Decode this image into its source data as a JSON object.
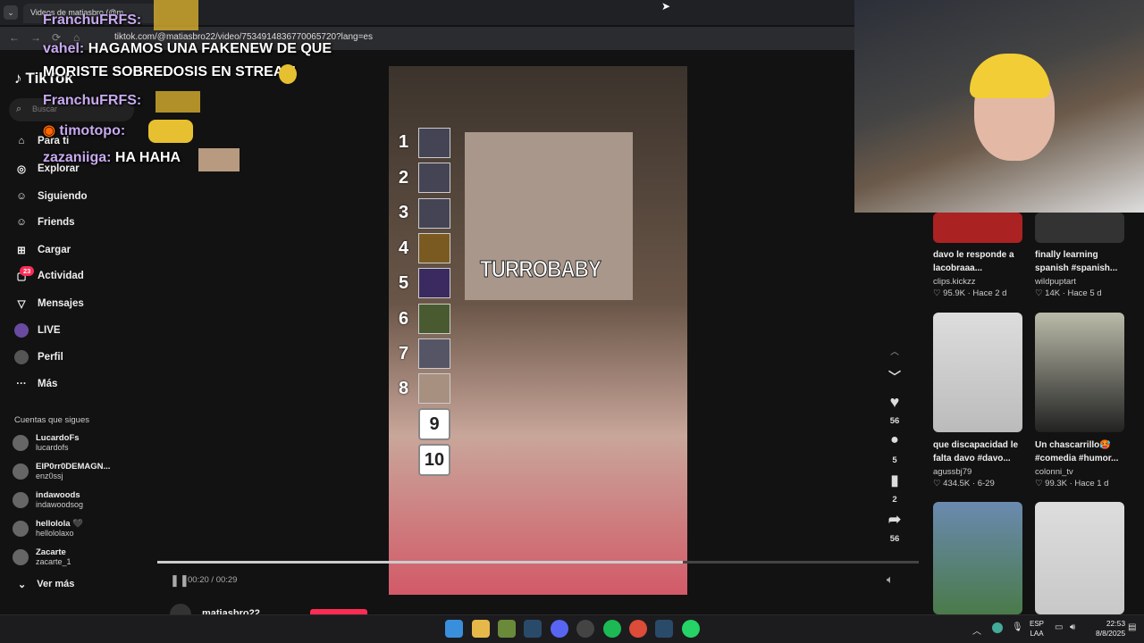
{
  "browser": {
    "tab_title": "Videos de matiasbro (@m",
    "url": "tiktok.com/@matiasbro22/video/7534914836770065720?lang=es"
  },
  "tiktok": {
    "logo": "TikTok",
    "search_placeholder": "Buscar",
    "nav": [
      {
        "label": "Para ti",
        "icon": "home-icon"
      },
      {
        "label": "Explorar",
        "icon": "compass-icon"
      },
      {
        "label": "Siguiendo",
        "icon": "following-icon"
      },
      {
        "label": "Friends",
        "icon": "friends-icon"
      },
      {
        "label": "Cargar",
        "icon": "upload-icon"
      },
      {
        "label": "Actividad",
        "icon": "inbox-icon",
        "badge": "23"
      },
      {
        "label": "Mensajes",
        "icon": "messages-icon"
      },
      {
        "label": "LIVE",
        "icon": "live-icon"
      },
      {
        "label": "Perfil",
        "icon": "avatar-icon"
      },
      {
        "label": "Más",
        "icon": "more-icon"
      }
    ],
    "following_heading": "Cuentas que sigues",
    "following": [
      {
        "name": "LucardoFs",
        "handle": "lucardofs"
      },
      {
        "name": "ElP0rr0DEMAGN...",
        "handle": "enz0ssj"
      },
      {
        "name": "indawoods",
        "handle": "indawoodsog"
      },
      {
        "name": "hellolola 🖤",
        "handle": "hellololaxo"
      },
      {
        "name": "Zacarte",
        "handle": "zacarte_1"
      }
    ],
    "see_more": "Ver más",
    "author_partial": "matiasbro22"
  },
  "video": {
    "overlay_text": "TURROBABY",
    "ranks": [
      "1",
      "2",
      "3",
      "4",
      "5",
      "6",
      "7",
      "8"
    ],
    "rank_boxes": [
      "9",
      "10"
    ],
    "time": "00:20 / 00:29",
    "progress_fraction": 0.69,
    "likes": "56",
    "comments": "5",
    "saves": "2",
    "shares": "56"
  },
  "chat": [
    {
      "user": "FranchuFRFS:",
      "msg": ""
    },
    {
      "user": "vahel:",
      "msg": "HAGAMOS UNA FAKENEW DE QUE"
    },
    {
      "user": "",
      "msg": "MORISTE SOBREDOSIS EN STREAM"
    },
    {
      "user": "FranchuFRFS:",
      "msg": ""
    },
    {
      "user": "timotopo:",
      "msg": ""
    },
    {
      "user": "zazaniiga:",
      "msg": "HA HAHA"
    }
  ],
  "recommendations": [
    {
      "title": "davo le responde a lacobraaa...",
      "author": "clips.kickzz",
      "meta": "♡ 95.9K · Hace 2 d"
    },
    {
      "title": "finally learning spanish #spanish...",
      "author": "wildpuptart",
      "meta": "♡ 14K · Hace 5 d"
    },
    {
      "title": "que discapacidad le falta davo #davo...",
      "author": "agussbj79",
      "meta": "♡ 434.5K · 6-29"
    },
    {
      "title": "Un chascarrillo🥵 #comedia #humor...",
      "author": "colonni_tv",
      "meta": "♡ 99.3K · Hace 1 d"
    }
  ],
  "taskbar": {
    "lang1": "ESP",
    "lang2": "LAA",
    "time": "22:53",
    "date": "8/8/2025"
  },
  "colors": {
    "accent": "#fe2c55",
    "badge": "#fe2c55"
  }
}
